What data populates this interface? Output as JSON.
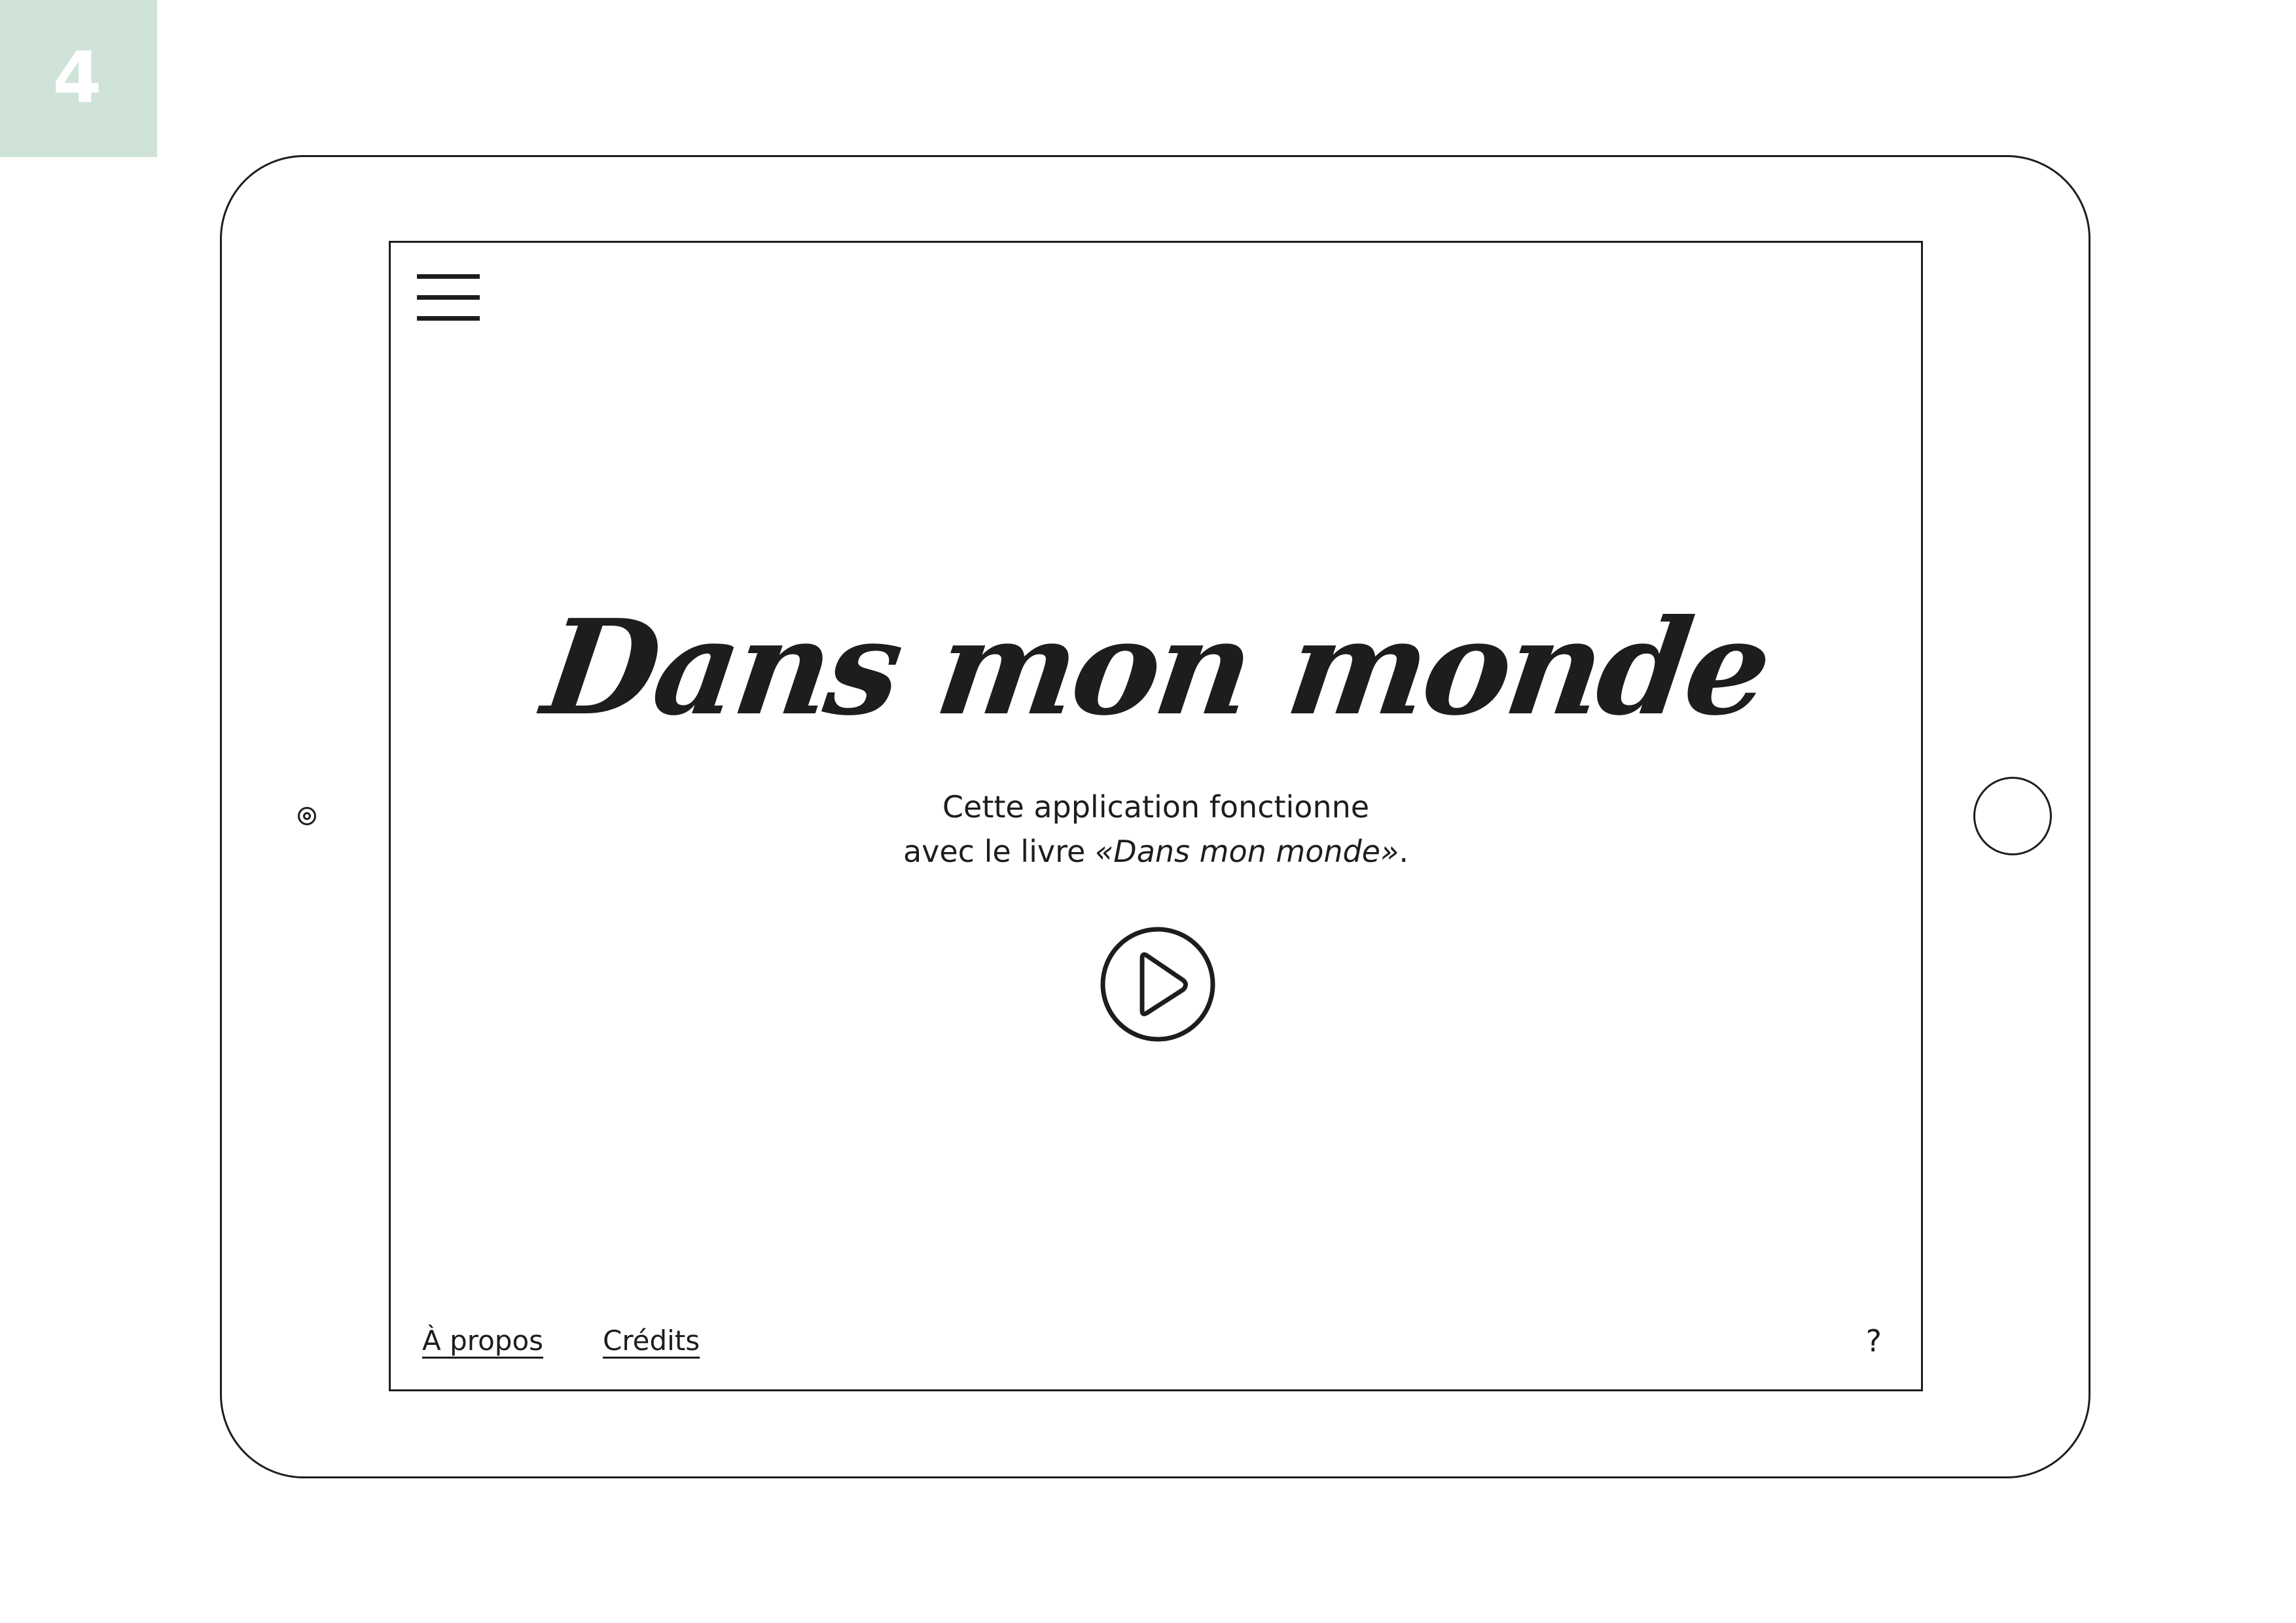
{
  "page": {
    "number": "4",
    "badge_color": "#cfe3d9"
  },
  "app": {
    "title": "Dans mon monde",
    "intro_line1": "Cette application fonctionne",
    "intro_line2_prefix": "avec le livre ",
    "intro_book_title": "«Dans mon monde»",
    "intro_line2_suffix": ".",
    "menu_icon": "hamburger-menu-icon",
    "play_icon": "play-circle-icon"
  },
  "footer": {
    "about_label": "À propos",
    "credits_label": "Crédits",
    "help_label": "?"
  },
  "colors": {
    "ink": "#1d1d1b",
    "background": "#ffffff"
  }
}
